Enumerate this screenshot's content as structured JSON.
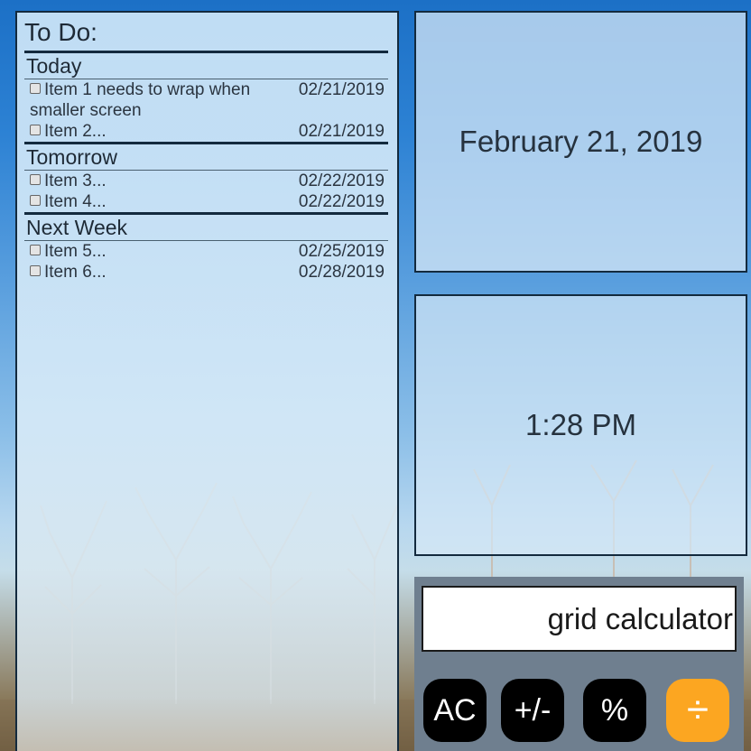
{
  "todo": {
    "title": "To Do:",
    "sections": [
      {
        "name": "Today",
        "items": [
          {
            "text": "Item 1 needs to wrap when smaller screen",
            "date": "02/21/2019"
          },
          {
            "text": "Item 2...",
            "date": "02/21/2019"
          }
        ]
      },
      {
        "name": "Tomorrow",
        "items": [
          {
            "text": "Item 3...",
            "date": "02/22/2019"
          },
          {
            "text": "Item 4...",
            "date": "02/22/2019"
          }
        ]
      },
      {
        "name": "Next Week",
        "items": [
          {
            "text": "Item 5...",
            "date": "02/25/2019"
          },
          {
            "text": "Item 6...",
            "date": "02/28/2019"
          }
        ]
      }
    ]
  },
  "date_widget": {
    "text": "February 21, 2019"
  },
  "time_widget": {
    "text": "1:28 PM"
  },
  "calculator": {
    "display": "grid calculator",
    "buttons": {
      "clear": "AC",
      "negate": "+/-",
      "percent": "%",
      "divide": "÷"
    },
    "operator_color": "#fca621"
  }
}
